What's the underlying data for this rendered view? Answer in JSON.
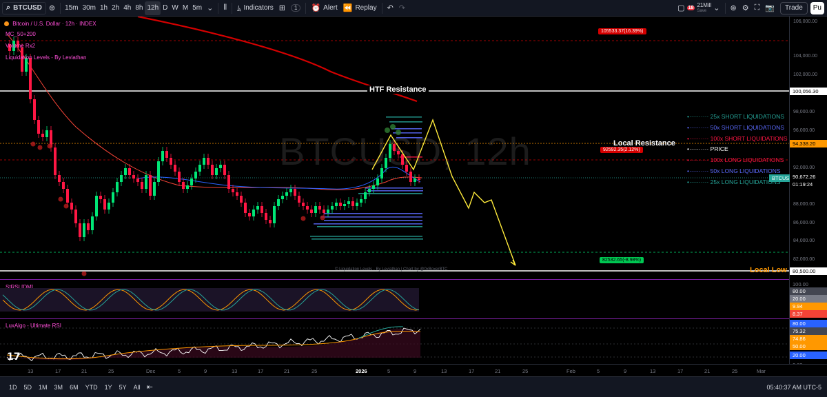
{
  "toolbar": {
    "symbol": "BTCUSD",
    "timeframes": [
      "15m",
      "30m",
      "1h",
      "2h",
      "4h",
      "8h",
      "12h",
      "D",
      "W",
      "M",
      "5m"
    ],
    "active_timeframe": "12h",
    "indicators_label": "Indicators",
    "indicators_count": "1",
    "alert_label": "Alert",
    "replay_label": "Replay",
    "layout_name": "21Mill",
    "layout_sub": "Save",
    "notif_count": "18",
    "trade_label": "Trade",
    "publish_label": "Pu"
  },
  "chart": {
    "title": "Bitcoin / U.S. Dollar · 12h · INDEX",
    "indicator_1": "MC_50+200",
    "indicator_2": "Volume Rx2",
    "indicator_3": "Liquidation Levels - By Leviathan",
    "watermark": "BTCUSD, 12h",
    "htf_resistance": "HTF Resistance",
    "local_resistance": "Local Resistance",
    "local_low": "Local Low",
    "footer_note": "© Liquidation Levels - By Leviathan | Chart by @0xBoxerBTC",
    "callout_up": "105533.37(16.39%)",
    "callout_mid": "92592.35(2.12%)",
    "callout_down": "82532.65(-8.98%)",
    "liq_legend": [
      {
        "label": "25x SHORT LIQUIDATIONS",
        "color": "#26a69a"
      },
      {
        "label": "50x SHORT LIQUIDATIONS",
        "color": "#5c6bff"
      },
      {
        "label": "100x SHORT LIQUIDATIONS",
        "color": "#ff1744"
      },
      {
        "label": "PRICE",
        "color": "#ffffff"
      },
      {
        "label": "100x LONG LIQUIDATIONS",
        "color": "#ff1744"
      },
      {
        "label": "50x LONG LIQUIDATIONS",
        "color": "#5c6bff"
      },
      {
        "label": "25x LONG LIQUIDATIONS",
        "color": "#26a69a"
      }
    ]
  },
  "price_scale": {
    "ticks": [
      "106,000.00",
      "104,000.00",
      "102,000.00",
      "98,000.00",
      "96,000.00",
      "92,000.00",
      "88,000.00",
      "86,000.00",
      "84,000.00",
      "82,000.00"
    ],
    "label_100056": "100,056.30",
    "label_94338": "94,338.20",
    "label_btcusd": "BTCUSD",
    "label_90672": "90,672.26",
    "label_countdown": "01:19:24",
    "label_80500": "80,500.00"
  },
  "rsi_pane": {
    "title": "StRSI [DM]",
    "labels": [
      "100.00",
      "80.00",
      "20.00",
      "9.94",
      "8.37"
    ]
  },
  "rsi2_pane": {
    "title": "LuxAlgo - Ultimate RSI",
    "labels": [
      "80.00",
      "75.32",
      "74.86",
      "50.00",
      "20.00",
      "0.00"
    ]
  },
  "time_axis": {
    "labels": [
      "13",
      "17",
      "21",
      "25",
      "Dec",
      "5",
      "9",
      "13",
      "17",
      "21",
      "25",
      "2026",
      "5",
      "9",
      "13",
      "17",
      "21",
      "25",
      "Feb",
      "5",
      "9",
      "13",
      "17",
      "21",
      "25",
      "Mar"
    ],
    "clock": "05:40:37 AM UTC-5"
  },
  "ranges": [
    "1D",
    "5D",
    "1M",
    "3M",
    "6M",
    "YTD",
    "1Y",
    "5Y",
    "All"
  ],
  "colors": {
    "bull": "#00e676",
    "bear": "#ff1744",
    "projection": "#ffeb3b",
    "ma200": "#d50000",
    "accent": "#7b1fa2"
  }
}
